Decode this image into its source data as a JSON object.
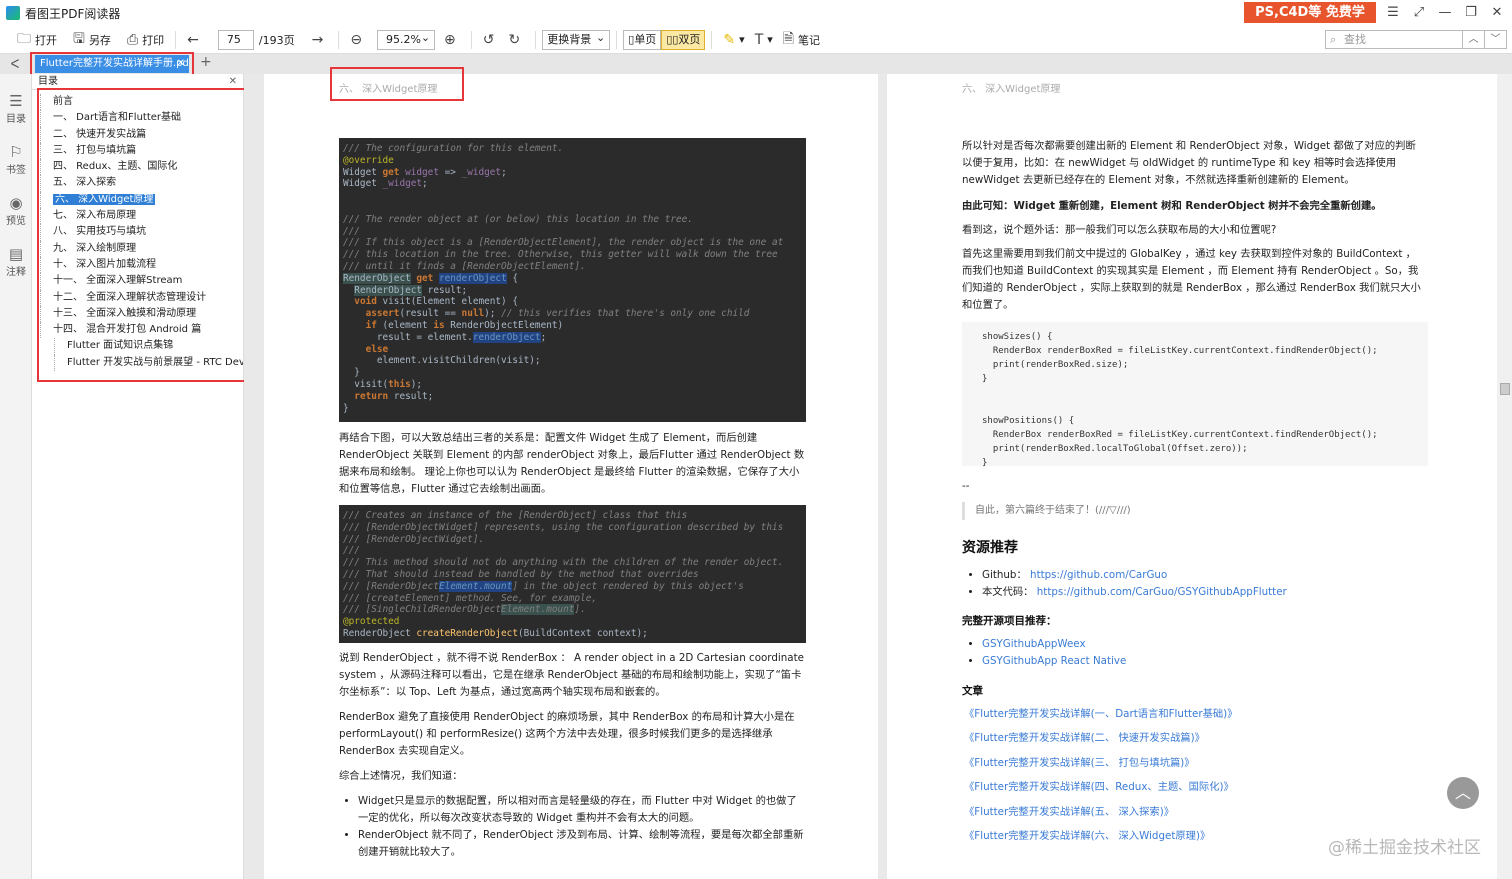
{
  "app": {
    "title": "看图王PDF阅读器",
    "ad": "PS,C4D等 免费学"
  },
  "window_controls": {
    "menu": "☰",
    "expand": "⤢",
    "min": "—",
    "max": "❐",
    "close": "✕"
  },
  "toolbar": {
    "open": "打开",
    "save_as": "另存",
    "print": "打印",
    "page_current": "75",
    "page_total": "/193页",
    "zoom": "95.2%",
    "background": "更换背景",
    "single": "单页",
    "double": "双页",
    "notes": "笔记",
    "search_placeholder": "查找"
  },
  "tab": {
    "label": "Flutter完整开发实战详解手册.pdf",
    "close": "✕",
    "add": "+"
  },
  "sidebar": {
    "toc": "目录",
    "bookmarks": "书签",
    "preview": "预览",
    "annotations": "注释"
  },
  "toc": {
    "title": "目录",
    "items": [
      "前言",
      "一、 Dart语言和Flutter基础",
      "二、 快速开发实战篇",
      "三、 打包与填坑篇",
      "四、 Redux、主题、国际化",
      "五、 深入探索",
      "六、 深入Widget原理",
      "七、 深入布局原理",
      "八、 实用技巧与填坑",
      "九、 深入绘制原理",
      "十、 深入图片加载流程",
      "十一、 全面深入理解Stream",
      "十二、 全面深入理解状态管理设计",
      "十三、 全面深入触摸和滑动原理",
      "十四、 混合开发打包 Android 篇",
      "Flutter 面试知识点集锦",
      "Flutter 开发实战与前景展望 - RTC Dev M"
    ]
  },
  "page_left": {
    "running_head": "六、 深入Widget原理",
    "para1": "再结合下图，可以大致总结出三者的关系是：配置文件 Widget 生成了 Element，而后创建 RenderObject 关联到 Element 的内部 renderObject 对象上，最后Flutter 通过 RenderObject 数据来布局和绘制。 理论上你也可以认为 RenderObject 是最终给 Flutter 的渲染数据，它保存了大小和位置等信息，Flutter 通过它去绘制出画面。",
    "para2": "说到 RenderObject ，就不得不说 RenderBox ： A render object in a 2D Cartesian coordinate system ，从源码注释可以看出，它是在继承 RenderObject 基础的布局和绘制功能上，实现了“笛卡尔坐标系”：以 Top、Left 为基点，通过宽高两个轴实现布局和嵌套的。",
    "para3": "RenderBox 避免了直接使用 RenderObject 的麻烦场景，其中 RenderBox 的布局和计算大小是在 performLayout() 和 performResize() 这两个方法中去处理，很多时候我们更多的是选择继承 RenderBox 去实现自定义。",
    "para4": "综合上述情况，我们知道：",
    "bullet1": "Widget只是显示的数据配置，所以相对而言是轻量级的存在，而 Flutter 中对 Widget 的也做了一定的优化，所以每次改变状态导致的 Widget 重构并不会有太大的问题。",
    "bullet2": "RenderObject 就不同了，RenderObject 涉及到布局、计算、绘制等流程，要是每次都全部重新创建开销就比较大了。"
  },
  "page_right": {
    "running_head": "六、 深入Widget原理",
    "para1": "所以针对是否每次都需要创建出新的 Element 和 RenderObject 对象，Widget 都做了对应的判断以便于复用，比如：在 newWidget 与 oldWidget 的 runtimeType 和 key 相等时会选择使用 newWidget 去更新已经存在的 Element 对象，不然就选择重新创建新的 Element。",
    "para2": "由此可知：Widget 重新创建，Element 树和 RenderObject 树并不会完全重新创建。",
    "para3": "看到这，说个题外话：那一般我们可以怎么获取布局的大小和位置呢?",
    "para4": "首先这里需要用到我们前文中提过的 GlobalKey ，通过 key 去获取到控件对象的 BuildContext ，而我们也知道 BuildContext 的实现其实是 Element ，而 Element 持有 RenderObject 。So，我们知道的 RenderObject ，实际上获取到的就是 RenderBox ，那么通过 RenderBox 我们就只大小和位置了。",
    "dash": "--",
    "quote": "自此，第六篇终于结束了！(///▽///)",
    "h_resources": "资源推荐",
    "github_label": "Github：",
    "github_link": "https://github.com/CarGuo",
    "code_label": "本文代码：",
    "code_link": "https://github.com/CarGuo/GSYGithubAppFlutter",
    "h_projects": "完整开源项目推荐：",
    "proj1": "GSYGithubAppWeex",
    "proj2": "GSYGithubApp React Native",
    "h_articles": "文章",
    "articles": [
      "《Flutter完整开发实战详解(一、Dart语言和Flutter基础)》",
      "《Flutter完整开发实战详解(二、 快速开发实战篇)》",
      "《Flutter完整开发实战详解(三、 打包与填坑篇)》",
      "《Flutter完整开发实战详解(四、Redux、主题、国际化)》",
      "《Flutter完整开发实战详解(五、 深入探索)》",
      "《Flutter完整开发实战详解(六、 深入Widget原理)》"
    ],
    "watermark": "@稀土掘金技术社区"
  }
}
